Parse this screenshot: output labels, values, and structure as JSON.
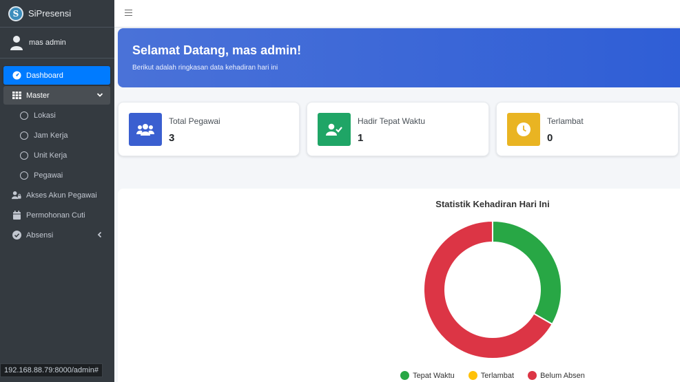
{
  "brand": {
    "name": "SiPresensi",
    "logo_letter": "S"
  },
  "user": {
    "name": "mas admin"
  },
  "nav": {
    "dashboard": "Dashboard",
    "master": "Master",
    "master_items": [
      "Lokasi",
      "Jam Kerja",
      "Unit Kerja",
      "Pegawai"
    ],
    "akses": "Akses Akun Pegawai",
    "cuti": "Permohonan Cuti",
    "absensi": "Absensi"
  },
  "status_url": "192.168.88.79:8000/admin#",
  "welcome": {
    "title": "Selamat Datang, mas admin!",
    "subtitle": "Berikut adalah ringkasan data kehadiran hari ini"
  },
  "cards": [
    {
      "label": "Total Pegawai",
      "value": "3",
      "color": "#3a5fd0",
      "icon": "users-icon"
    },
    {
      "label": "Hadir Tepat Waktu",
      "value": "1",
      "color": "#1fa566",
      "icon": "user-check-icon"
    },
    {
      "label": "Terlambat",
      "value": "0",
      "color": "#e9b422",
      "icon": "clock-icon"
    }
  ],
  "chart_data": {
    "type": "pie",
    "title": "Statistik Kehadiran Hari Ini",
    "categories": [
      "Tepat Waktu",
      "Terlambat",
      "Belum Absen"
    ],
    "values": [
      1,
      0,
      2
    ],
    "colors": [
      "#28a745",
      "#ffc107",
      "#dc3545"
    ],
    "legend": "bottom"
  }
}
